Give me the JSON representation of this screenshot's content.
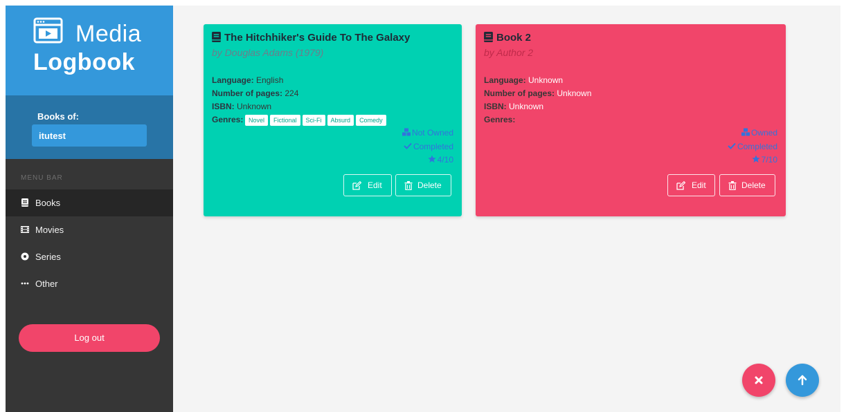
{
  "brand": {
    "title_top": "Media",
    "title_bottom": "Logbook"
  },
  "user": {
    "label": "Books of:",
    "name": "itutest"
  },
  "menu": {
    "label": "MENU BAR",
    "items": [
      {
        "label": "Books",
        "icon": "book-icon",
        "active": true
      },
      {
        "label": "Movies",
        "icon": "film-icon",
        "active": false
      },
      {
        "label": "Series",
        "icon": "disc-icon",
        "active": false
      },
      {
        "label": "Other",
        "icon": "ellipsis-icon",
        "active": false
      }
    ]
  },
  "logout": "Log out",
  "cards": [
    {
      "color": "#00d1b2",
      "title": "The Hitchhiker's Guide To The Galaxy",
      "author": "by Douglas Adams (1979)",
      "language_label": "Language:",
      "language": " English",
      "pages_label": "Number of pages:",
      "pages": " 224",
      "isbn_label": "ISBN:",
      "isbn": " Unknown",
      "genres_label": "Genres:",
      "genres": [
        "Novel",
        "Fictional",
        "Sci-Fi",
        "Absurd",
        "Comedy"
      ],
      "owned": "Not Owned",
      "completed": "Completed",
      "rating": "4/10",
      "edit": "Edit",
      "delete": "Delete"
    },
    {
      "color": "#f1456a",
      "title": "Book 2",
      "author": "by Author 2",
      "language_label": "Language:",
      "language": " Unknown",
      "pages_label": "Number of pages:",
      "pages": " Unknown",
      "isbn_label": "ISBN:",
      "isbn": " Unknown",
      "genres_label": "Genres:",
      "genres": [],
      "owned": "Owned",
      "completed": "Completed",
      "rating": "7/10",
      "edit": "Edit",
      "delete": "Delete"
    }
  ],
  "colors": {
    "primary": "#3498db",
    "danger": "#f1456a",
    "success": "#00d1b2",
    "link": "#3273dc"
  }
}
